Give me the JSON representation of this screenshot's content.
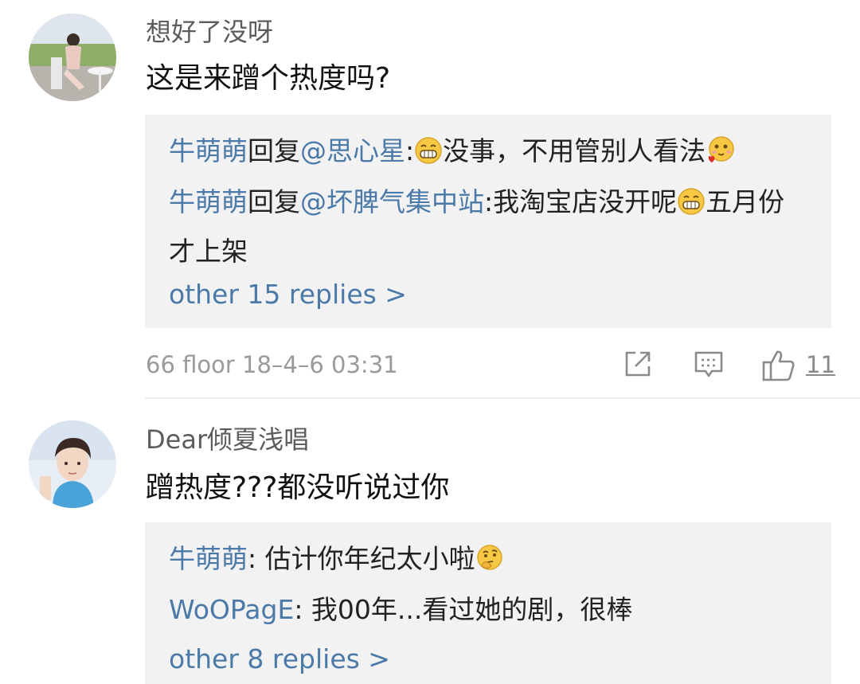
{
  "comments": [
    {
      "username": "想好了没呀",
      "text": "这是来蹭个热度吗?",
      "replies": [
        {
          "name": "牛萌萌",
          "verb": "回复",
          "target": "@思心星",
          "sep": ":",
          "text_a": "没事，不用管别人看法",
          "text_b": ""
        },
        {
          "name": "牛萌萌",
          "verb": "回复",
          "target": "@坏脾气集中站",
          "sep": ":",
          "text_a": "我淘宝店没开呢",
          "text_b": "五月份才上架"
        }
      ],
      "more_replies": "other 15 replies >",
      "meta": "66 floor 18–4–6 03:31",
      "like_count": "11"
    },
    {
      "username": "Dear倾夏浅唱",
      "text": "蹭热度???都没听说过你",
      "replies": [
        {
          "name": "牛萌萌",
          "sep": ": ",
          "text": "估计你年纪太小啦"
        },
        {
          "name": "WoOPagE",
          "sep": ": ",
          "text": "我00年...看过她的剧，很棒"
        }
      ],
      "more_replies": "other 8 replies >"
    }
  ],
  "icons": {
    "share": "share-icon",
    "comment": "comment-icon",
    "like": "thumbs-up-icon",
    "grin": "grin-emoji-icon",
    "love": "love-emoji-icon",
    "thinking": "thinking-emoji-icon"
  },
  "colors": {
    "link": "#4b79a8",
    "reply_bg": "#f2f2f2",
    "meta": "#9a9a9a"
  }
}
